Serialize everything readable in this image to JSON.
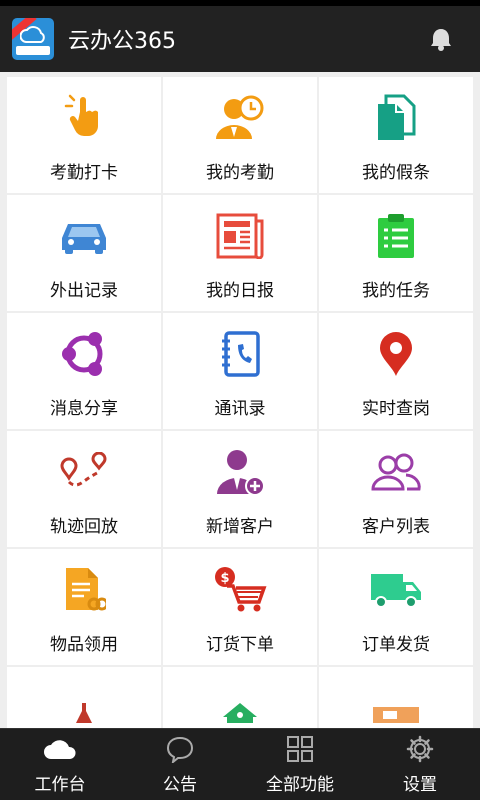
{
  "app": {
    "title": "云办公365"
  },
  "grid": {
    "items": [
      {
        "label": "考勤打卡",
        "icon": "tap-hand-icon"
      },
      {
        "label": "我的考勤",
        "icon": "person-clock-icon"
      },
      {
        "label": "我的假条",
        "icon": "documents-icon"
      },
      {
        "label": "外出记录",
        "icon": "car-icon"
      },
      {
        "label": "我的日报",
        "icon": "newspaper-icon"
      },
      {
        "label": "我的任务",
        "icon": "clipboard-icon"
      },
      {
        "label": "消息分享",
        "icon": "share-icon"
      },
      {
        "label": "通讯录",
        "icon": "contact-book-icon"
      },
      {
        "label": "实时查岗",
        "icon": "location-pin-icon"
      },
      {
        "label": "轨迹回放",
        "icon": "route-icon"
      },
      {
        "label": "新增客户",
        "icon": "add-person-icon"
      },
      {
        "label": "客户列表",
        "icon": "people-icon"
      },
      {
        "label": "物品领用",
        "icon": "item-document-icon"
      },
      {
        "label": "订货下单",
        "icon": "shopping-cart-icon"
      },
      {
        "label": "订单发货",
        "icon": "truck-icon"
      }
    ]
  },
  "tabs": [
    {
      "label": "工作台",
      "icon": "cloud-icon"
    },
    {
      "label": "公告",
      "icon": "chat-bubble-icon"
    },
    {
      "label": "全部功能",
      "icon": "grid-icon"
    },
    {
      "label": "设置",
      "icon": "gear-icon"
    }
  ],
  "colors": {
    "appbar": "#222222",
    "tabbar": "#1e1e1e",
    "grid_bg": "#eeeeee"
  }
}
